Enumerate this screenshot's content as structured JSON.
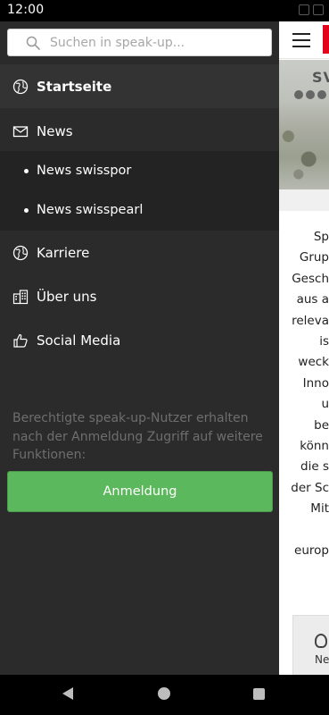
{
  "status_bar": {
    "time": "12:00"
  },
  "search": {
    "placeholder": "Suchen in speak-up..."
  },
  "menu": {
    "items": [
      {
        "label": "Startseite",
        "icon": "globe-icon",
        "active": true
      },
      {
        "label": "News",
        "icon": "envelope-icon"
      },
      {
        "label": "Karriere",
        "icon": "globe-icon"
      },
      {
        "label": "Über uns",
        "icon": "building-icon"
      },
      {
        "label": "Social Media",
        "icon": "thumbs-up-icon"
      }
    ],
    "news_subitems": [
      {
        "label": "News swisspor"
      },
      {
        "label": "News swisspearl"
      }
    ]
  },
  "login": {
    "note": "Berechtigte speak-up-Nutzer erhalten nach der Anmeldung Zugriff auf weitere Funktionen:",
    "button_label": "Anmeldung"
  },
  "background_app": {
    "hero_text": "SV",
    "article_lines": [
      "Sp",
      "Grup",
      "Gesch",
      "aus a",
      "releva",
      "is",
      "weck",
      "Inno",
      "u",
      "be",
      "könn",
      "die s",
      "der Sc",
      "Mit",
      "",
      "europ"
    ],
    "card_label": "Ne"
  },
  "colors": {
    "drawer_bg": "#2b2b2b",
    "active_item_bg": "#333333",
    "submenu_bg": "#232323",
    "login_button": "#5cb85c",
    "brand_red": "#e3051b"
  }
}
